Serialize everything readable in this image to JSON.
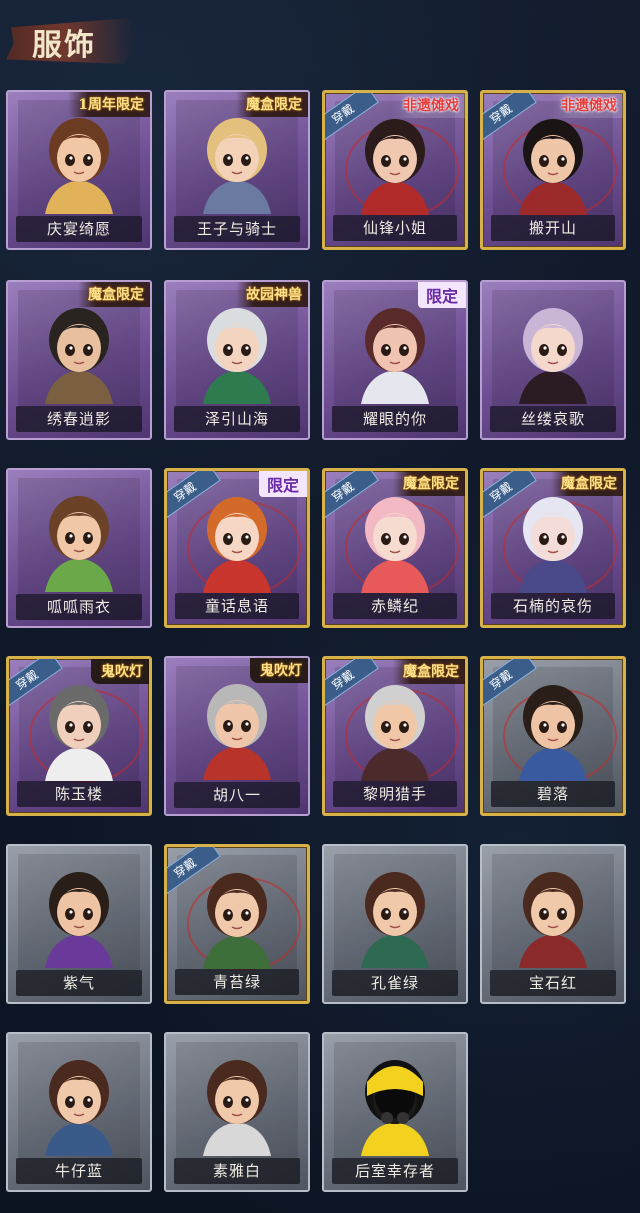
{
  "page": {
    "title": "服饰"
  },
  "cards": [
    {
      "name": "庆宴绮愿",
      "tag": "1周年限定",
      "tag_style": "gold",
      "style": "purple",
      "equipped": false,
      "hair": "#6b3b22",
      "skin": "#f2c7a6",
      "accent": "#e2b25a"
    },
    {
      "name": "王子与骑士",
      "tag": "魔盒限定",
      "tag_style": "gold",
      "style": "purple",
      "equipped": false,
      "hair": "#e3c07d",
      "skin": "#f3d2b8",
      "accent": "#6b7aa0"
    },
    {
      "name": "仙锋小姐",
      "tag": "非遗傩戏",
      "tag_style": "red",
      "style": "purple",
      "equipped": true,
      "hair": "#2b1b1b",
      "skin": "#f0c8b0",
      "accent": "#b02a2a"
    },
    {
      "name": "搬开山",
      "tag": "非遗傩戏",
      "tag_style": "red",
      "style": "purple",
      "equipped": true,
      "hair": "#1b1414",
      "skin": "#efc6a8",
      "accent": "#9c2a2a"
    },
    {
      "name": "绣春逍影",
      "tag": "魔盒限定",
      "tag_style": "gold",
      "style": "purple",
      "equipped": false,
      "hair": "#2a2420",
      "skin": "#e8c0a0",
      "accent": "#7a6040"
    },
    {
      "name": "泽引山海",
      "tag": "故园神兽",
      "tag_style": "gold",
      "style": "purple",
      "equipped": false,
      "hair": "#d9dde0",
      "skin": "#f2d4c0",
      "accent": "#2e7b50"
    },
    {
      "name": "耀眼的你",
      "tag": "限定",
      "tag_style": "limited",
      "style": "purple",
      "equipped": false,
      "hair": "#5a2a2a",
      "skin": "#f0c4b0",
      "accent": "#e6e6ee"
    },
    {
      "name": "丝缕哀歌",
      "tag": "",
      "tag_style": "",
      "style": "purple",
      "equipped": false,
      "hair": "#c9b6d6",
      "skin": "#f4d8cc",
      "accent": "#2a1c22"
    },
    {
      "name": "呱呱雨衣",
      "tag": "",
      "tag_style": "",
      "style": "purple",
      "equipped": false,
      "hair": "#6b4228",
      "skin": "#f0c8a8",
      "accent": "#6aa84a"
    },
    {
      "name": "童话息语",
      "tag": "限定",
      "tag_style": "limited",
      "style": "purple",
      "equipped": true,
      "hair": "#d46a2a",
      "skin": "#f6d6c4",
      "accent": "#c8362e"
    },
    {
      "name": "赤鳞纪",
      "tag": "魔盒限定",
      "tag_style": "gold",
      "style": "purple",
      "equipped": true,
      "hair": "#f2b8c4",
      "skin": "#f6dcd0",
      "accent": "#e85a5a"
    },
    {
      "name": "石楠的哀伤",
      "tag": "魔盒限定",
      "tag_style": "gold",
      "style": "purple",
      "equipped": true,
      "hair": "#e6e6f2",
      "skin": "#f4dcd8",
      "accent": "#4a4a8a"
    },
    {
      "name": "陈玉楼",
      "tag": "鬼吹灯",
      "tag_style": "ghost",
      "style": "purple",
      "equipped": true,
      "hair": "#6a6a6a",
      "skin": "#f0d0bc",
      "accent": "#eeeeee"
    },
    {
      "name": "胡八一",
      "tag": "鬼吹灯",
      "tag_style": "ghost",
      "style": "purple",
      "equipped": false,
      "hair": "#b8b8b8",
      "skin": "#efc6aa",
      "accent": "#b8342a"
    },
    {
      "name": "黎明猎手",
      "tag": "魔盒限定",
      "tag_style": "gold",
      "style": "purple",
      "equipped": true,
      "hair": "#d0d0d0",
      "skin": "#f0c8a8",
      "accent": "#4a2a2a"
    },
    {
      "name": "碧落",
      "tag": "",
      "tag_style": "",
      "style": "grey",
      "equipped": true,
      "hair": "#2a1e18",
      "skin": "#eec4a4",
      "accent": "#3a5aa0"
    },
    {
      "name": "紫气",
      "tag": "",
      "tag_style": "",
      "style": "grey",
      "equipped": false,
      "hair": "#2a1e18",
      "skin": "#eec4a4",
      "accent": "#6a3a9a"
    },
    {
      "name": "青苔绿",
      "tag": "",
      "tag_style": "",
      "style": "grey",
      "equipped": true,
      "hair": "#4a2a1e",
      "skin": "#f0c8aa",
      "accent": "#3e6e3a"
    },
    {
      "name": "孔雀绿",
      "tag": "",
      "tag_style": "",
      "style": "grey",
      "equipped": false,
      "hair": "#4a2a1e",
      "skin": "#f0c8aa",
      "accent": "#2e6a52"
    },
    {
      "name": "宝石红",
      "tag": "",
      "tag_style": "",
      "style": "grey",
      "equipped": false,
      "hair": "#4a2a1e",
      "skin": "#f0c8aa",
      "accent": "#8a2a2a"
    },
    {
      "name": "牛仔蓝",
      "tag": "",
      "tag_style": "",
      "style": "grey",
      "equipped": false,
      "hair": "#4a2a1e",
      "skin": "#f0c8aa",
      "accent": "#3a5a8a"
    },
    {
      "name": "素雅白",
      "tag": "",
      "tag_style": "",
      "style": "grey",
      "equipped": false,
      "hair": "#4a2a1e",
      "skin": "#f0c8aa",
      "accent": "#d8d8d8"
    },
    {
      "name": "后室幸存者",
      "tag": "",
      "tag_style": "",
      "style": "grey",
      "equipped": false,
      "hair": "#111111",
      "skin": "#1a1a1a",
      "accent": "#f2d21e",
      "mask": true
    }
  ],
  "equipped_label": "穿戴"
}
